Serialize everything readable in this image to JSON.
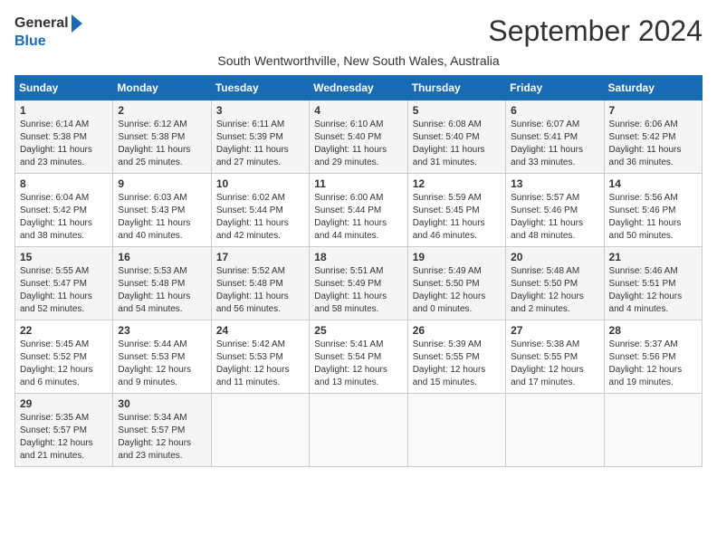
{
  "header": {
    "logo_general": "General",
    "logo_blue": "Blue",
    "title": "September 2024",
    "subtitle": "South Wentworthville, New South Wales, Australia"
  },
  "days_of_week": [
    "Sunday",
    "Monday",
    "Tuesday",
    "Wednesday",
    "Thursday",
    "Friday",
    "Saturday"
  ],
  "weeks": [
    [
      {
        "day": "1",
        "sunrise": "6:14 AM",
        "sunset": "5:38 PM",
        "daylight": "11 hours and 23 minutes."
      },
      {
        "day": "2",
        "sunrise": "6:12 AM",
        "sunset": "5:38 PM",
        "daylight": "11 hours and 25 minutes."
      },
      {
        "day": "3",
        "sunrise": "6:11 AM",
        "sunset": "5:39 PM",
        "daylight": "11 hours and 27 minutes."
      },
      {
        "day": "4",
        "sunrise": "6:10 AM",
        "sunset": "5:40 PM",
        "daylight": "11 hours and 29 minutes."
      },
      {
        "day": "5",
        "sunrise": "6:08 AM",
        "sunset": "5:40 PM",
        "daylight": "11 hours and 31 minutes."
      },
      {
        "day": "6",
        "sunrise": "6:07 AM",
        "sunset": "5:41 PM",
        "daylight": "11 hours and 33 minutes."
      },
      {
        "day": "7",
        "sunrise": "6:06 AM",
        "sunset": "5:42 PM",
        "daylight": "11 hours and 36 minutes."
      }
    ],
    [
      {
        "day": "8",
        "sunrise": "6:04 AM",
        "sunset": "5:42 PM",
        "daylight": "11 hours and 38 minutes."
      },
      {
        "day": "9",
        "sunrise": "6:03 AM",
        "sunset": "5:43 PM",
        "daylight": "11 hours and 40 minutes."
      },
      {
        "day": "10",
        "sunrise": "6:02 AM",
        "sunset": "5:44 PM",
        "daylight": "11 hours and 42 minutes."
      },
      {
        "day": "11",
        "sunrise": "6:00 AM",
        "sunset": "5:44 PM",
        "daylight": "11 hours and 44 minutes."
      },
      {
        "day": "12",
        "sunrise": "5:59 AM",
        "sunset": "5:45 PM",
        "daylight": "11 hours and 46 minutes."
      },
      {
        "day": "13",
        "sunrise": "5:57 AM",
        "sunset": "5:46 PM",
        "daylight": "11 hours and 48 minutes."
      },
      {
        "day": "14",
        "sunrise": "5:56 AM",
        "sunset": "5:46 PM",
        "daylight": "11 hours and 50 minutes."
      }
    ],
    [
      {
        "day": "15",
        "sunrise": "5:55 AM",
        "sunset": "5:47 PM",
        "daylight": "11 hours and 52 minutes."
      },
      {
        "day": "16",
        "sunrise": "5:53 AM",
        "sunset": "5:48 PM",
        "daylight": "11 hours and 54 minutes."
      },
      {
        "day": "17",
        "sunrise": "5:52 AM",
        "sunset": "5:48 PM",
        "daylight": "11 hours and 56 minutes."
      },
      {
        "day": "18",
        "sunrise": "5:51 AM",
        "sunset": "5:49 PM",
        "daylight": "11 hours and 58 minutes."
      },
      {
        "day": "19",
        "sunrise": "5:49 AM",
        "sunset": "5:50 PM",
        "daylight": "12 hours and 0 minutes."
      },
      {
        "day": "20",
        "sunrise": "5:48 AM",
        "sunset": "5:50 PM",
        "daylight": "12 hours and 2 minutes."
      },
      {
        "day": "21",
        "sunrise": "5:46 AM",
        "sunset": "5:51 PM",
        "daylight": "12 hours and 4 minutes."
      }
    ],
    [
      {
        "day": "22",
        "sunrise": "5:45 AM",
        "sunset": "5:52 PM",
        "daylight": "12 hours and 6 minutes."
      },
      {
        "day": "23",
        "sunrise": "5:44 AM",
        "sunset": "5:53 PM",
        "daylight": "12 hours and 9 minutes."
      },
      {
        "day": "24",
        "sunrise": "5:42 AM",
        "sunset": "5:53 PM",
        "daylight": "12 hours and 11 minutes."
      },
      {
        "day": "25",
        "sunrise": "5:41 AM",
        "sunset": "5:54 PM",
        "daylight": "12 hours and 13 minutes."
      },
      {
        "day": "26",
        "sunrise": "5:39 AM",
        "sunset": "5:55 PM",
        "daylight": "12 hours and 15 minutes."
      },
      {
        "day": "27",
        "sunrise": "5:38 AM",
        "sunset": "5:55 PM",
        "daylight": "12 hours and 17 minutes."
      },
      {
        "day": "28",
        "sunrise": "5:37 AM",
        "sunset": "5:56 PM",
        "daylight": "12 hours and 19 minutes."
      }
    ],
    [
      {
        "day": "29",
        "sunrise": "5:35 AM",
        "sunset": "5:57 PM",
        "daylight": "12 hours and 21 minutes."
      },
      {
        "day": "30",
        "sunrise": "5:34 AM",
        "sunset": "5:57 PM",
        "daylight": "12 hours and 23 minutes."
      },
      null,
      null,
      null,
      null,
      null
    ]
  ],
  "labels": {
    "sunrise": "Sunrise: ",
    "sunset": "Sunset: ",
    "daylight": "Daylight: "
  }
}
